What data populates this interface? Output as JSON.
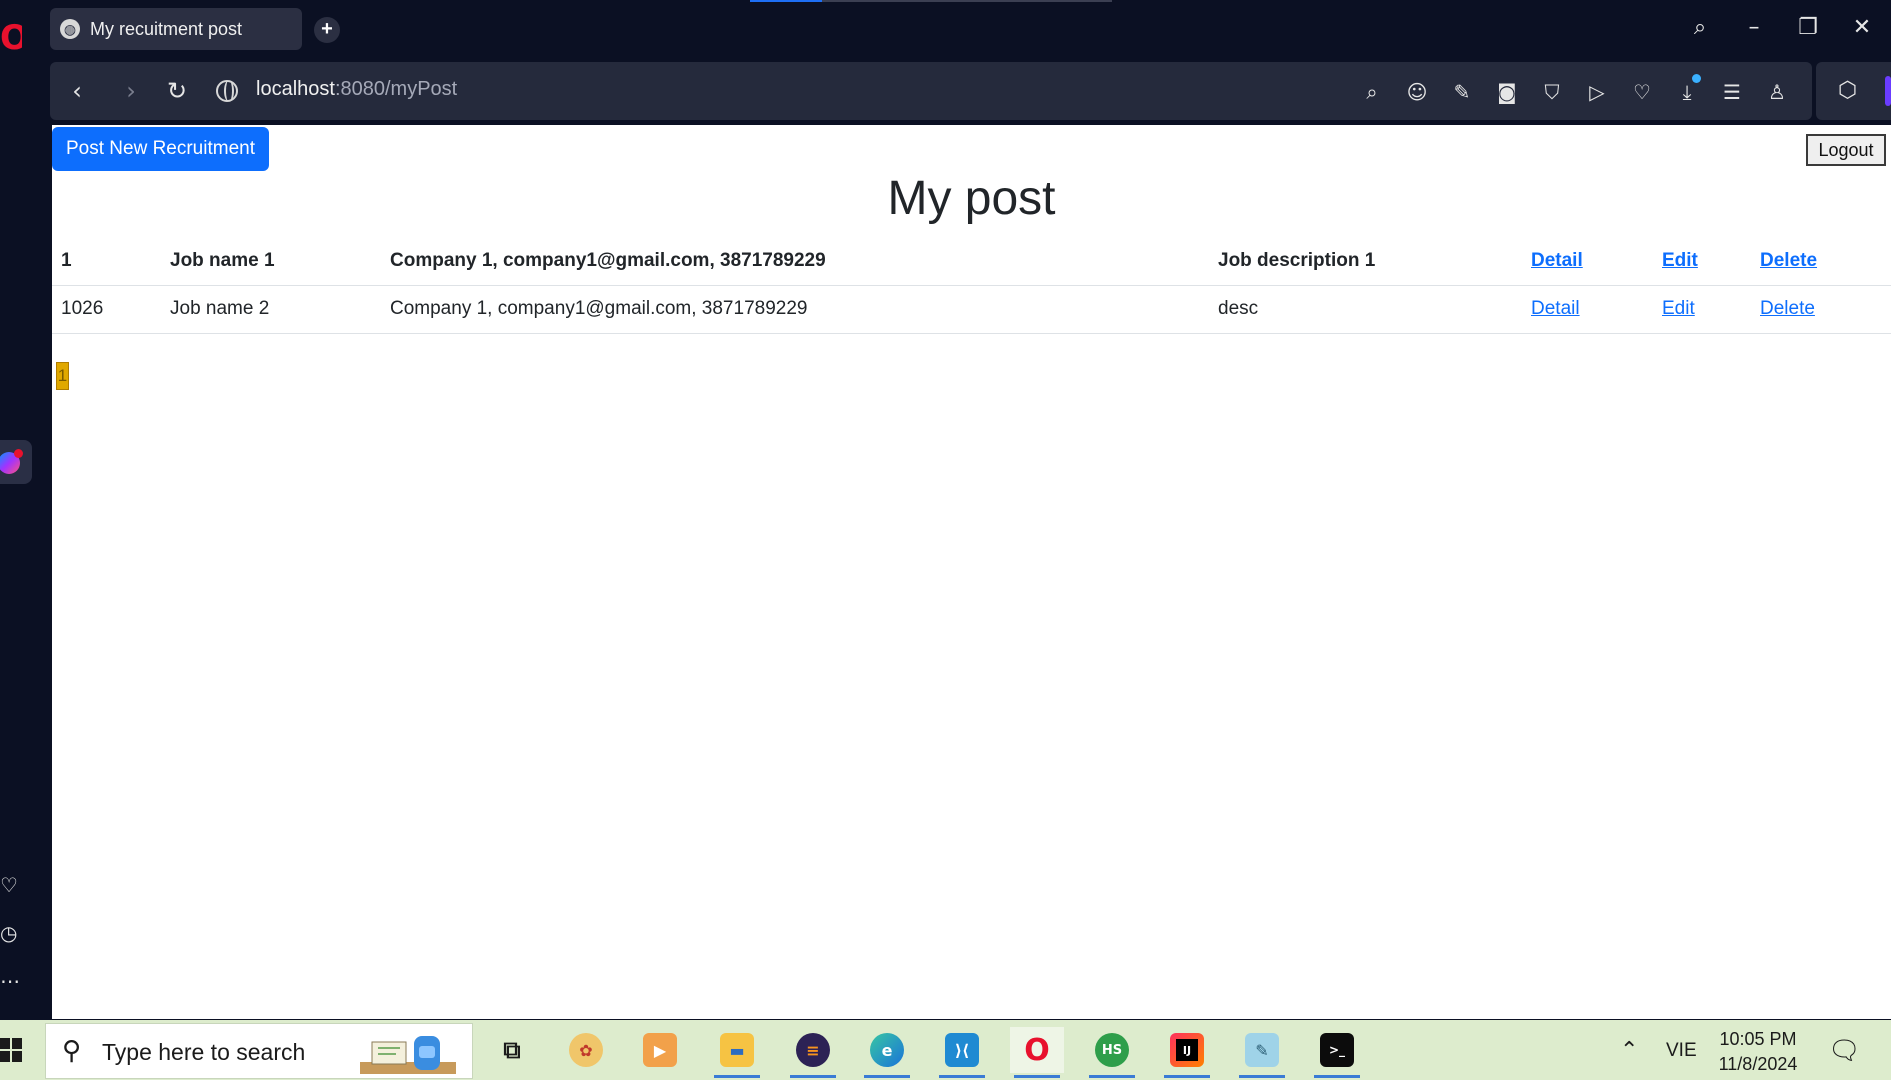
{
  "browser": {
    "tab_title": "My recuitment post",
    "url_host": "localhost",
    "url_path": ":8080/myPost"
  },
  "page": {
    "post_button": "Post New Recruitment",
    "logout_button": "Logout",
    "title": "My post",
    "table": {
      "rows": [
        {
          "id": "1",
          "job": "Job name 1",
          "company": "Company 1, company1@gmail.com, 3871789229",
          "description": "Job description 1",
          "detail": "Detail",
          "edit": "Edit",
          "delete": "Delete"
        },
        {
          "id": "1026",
          "job": "Job name 2",
          "company": "Company 1, company1@gmail.com, 3871789229",
          "description": "desc",
          "detail": "Detail",
          "edit": "Edit",
          "delete": "Delete"
        }
      ]
    },
    "pagination": {
      "current_page": "1"
    }
  },
  "taskbar": {
    "search_placeholder": "Type here to search",
    "language": "VIE",
    "time": "10:05 PM",
    "date": "11/8/2024",
    "apps": [
      "task-view",
      "paint",
      "media-player",
      "file-explorer",
      "eclipse",
      "edge",
      "vscode",
      "opera",
      "heidisql",
      "intellij",
      "notepad",
      "terminal"
    ]
  },
  "colors": {
    "primary_button": "#0d6efd",
    "link": "#0d6efd",
    "page_label_highlight": "#e0a800",
    "browser_chrome": "#0b1023"
  }
}
